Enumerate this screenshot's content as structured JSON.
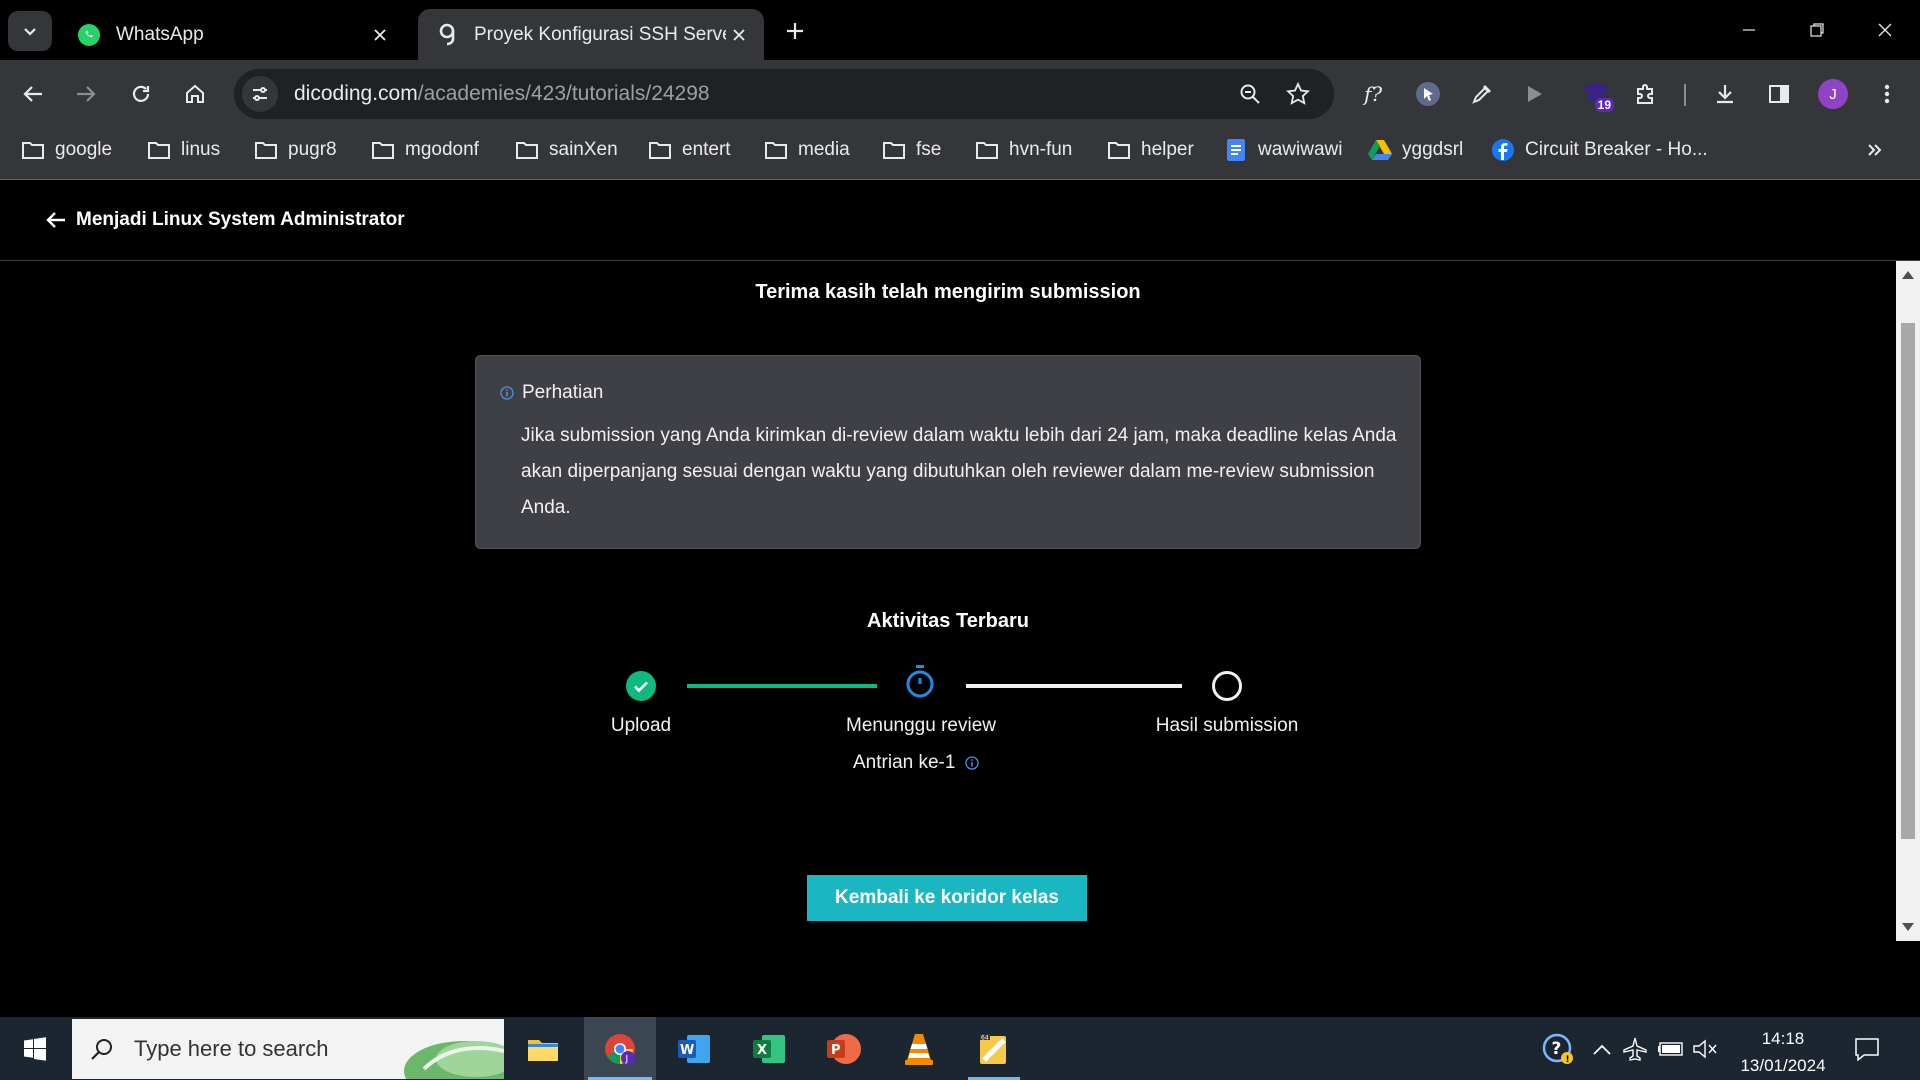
{
  "browser": {
    "tabs": [
      {
        "title": "WhatsApp",
        "icon": "whatsapp-icon",
        "active": false
      },
      {
        "title": "Proyek Konfigurasi SSH Server |",
        "icon": "dicoding-icon",
        "active": true
      }
    ],
    "url": {
      "domain": "dicoding.com",
      "path": "/academies/423/tutorials/24298"
    },
    "extension_badge": "19",
    "profile_initial": "J",
    "bookmarks": [
      {
        "label": "google",
        "icon": "folder-icon"
      },
      {
        "label": "linus",
        "icon": "folder-icon"
      },
      {
        "label": "pugr8",
        "icon": "folder-icon"
      },
      {
        "label": "mgodonf",
        "icon": "folder-icon"
      },
      {
        "label": "sainXen",
        "icon": "folder-icon"
      },
      {
        "label": "entert",
        "icon": "folder-icon"
      },
      {
        "label": "media",
        "icon": "folder-icon"
      },
      {
        "label": "fse",
        "icon": "folder-icon"
      },
      {
        "label": "hvn-fun",
        "icon": "folder-icon"
      },
      {
        "label": "helper",
        "icon": "folder-icon"
      },
      {
        "label": "wawiwawi",
        "icon": "docs-icon"
      },
      {
        "label": "yggdsrl",
        "icon": "drive-icon"
      },
      {
        "label": "Circuit Breaker - Ho...",
        "icon": "facebook-icon"
      }
    ]
  },
  "page": {
    "back_label": "Menjadi Linux System Administrator",
    "heading": "Terima kasih telah mengirim submission",
    "notice": {
      "title": "Perhatian",
      "body": "Jika submission yang Anda kirimkan di-review dalam waktu lebih dari 24 jam, maka deadline kelas Anda akan diperpanjang sesuai dengan waktu yang dibutuhkan oleh reviewer dalam me-review submission Anda."
    },
    "activity_title": "Aktivitas Terbaru",
    "steps": [
      {
        "label": "Upload",
        "status": "done"
      },
      {
        "label": "Menunggu review",
        "status": "in-progress"
      },
      {
        "label": "Hasil submission",
        "status": "pending"
      }
    ],
    "queue_text": "Antrian ke-1",
    "cta_label": "Kembali ke koridor kelas",
    "colors": {
      "accent": "#1ab7c3",
      "success": "#10b981",
      "progress": "#1d8ae3"
    }
  },
  "taskbar": {
    "search_placeholder": "Type here to search",
    "apps": [
      "file-explorer-icon",
      "chrome-icon",
      "word-icon",
      "excel-icon",
      "powerpoint-icon",
      "vlc-icon",
      "app-icon"
    ],
    "time": "14:18",
    "date": "13/01/2024"
  }
}
